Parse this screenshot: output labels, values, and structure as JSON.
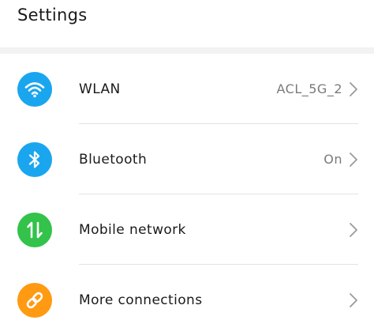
{
  "header": {
    "title": "Settings"
  },
  "colors": {
    "wlan": "#1aa6ee",
    "bluetooth": "#1aa6ee",
    "mobile_network": "#33c24a",
    "more_connections": "#ff9a12"
  },
  "settings": {
    "items": [
      {
        "icon": "wifi-icon",
        "label": "WLAN",
        "value": "ACL_5G_2"
      },
      {
        "icon": "bluetooth-icon",
        "label": "Bluetooth",
        "value": "On"
      },
      {
        "icon": "mobile-data-arrows-icon",
        "label": "Mobile network",
        "value": ""
      },
      {
        "icon": "link-icon",
        "label": "More connections",
        "value": ""
      }
    ]
  }
}
